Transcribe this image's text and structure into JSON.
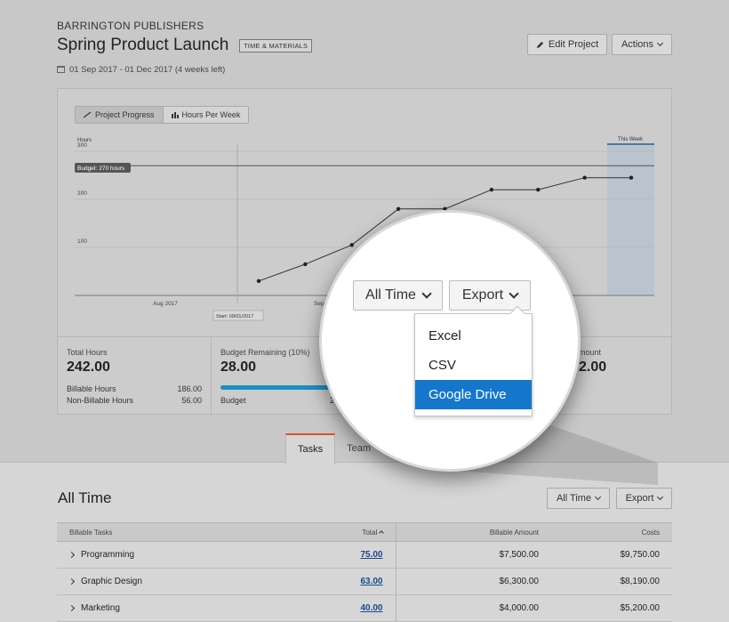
{
  "header": {
    "company": "BARRINGTON PUBLISHERS",
    "title": "Spring Product Launch",
    "tag": "TIME & MATERIALS",
    "dates": "01 Sep 2017 - 01 Dec 2017 (4 weeks left)",
    "edit_label": "Edit Project",
    "actions_label": "Actions"
  },
  "chart_toggle": {
    "progress": "Project Progress",
    "hours": "Hours Per Week"
  },
  "chart_data": {
    "type": "line",
    "ylabel": "Hours",
    "y_ticks": [
      100,
      200,
      300
    ],
    "ylim": [
      0,
      300
    ],
    "x_tick_labels": [
      "Aug 2017",
      "Sep"
    ],
    "budget_line": {
      "value": 270,
      "label": "Budget: 270 hours"
    },
    "start_marker": "Start: 09/01/2017",
    "this_week_label": "This Week",
    "series": [
      {
        "values": [
          30,
          65,
          105,
          180,
          180,
          220,
          220,
          245,
          245
        ]
      }
    ]
  },
  "stats": {
    "total_hours": {
      "label": "Total Hours",
      "value": "242.00",
      "billable_label": "Billable Hours",
      "billable_value": "186.00",
      "nonbillable_label": "Non-Billable Hours",
      "nonbillable_value": "56.00"
    },
    "budget_remaining": {
      "label": "Budget Remaining (10%)",
      "value": "28.00",
      "budget_label": "Budget",
      "budget_value_partial": "2",
      "progress": 0.9
    },
    "amount": {
      "label_partial": "mount",
      "value_partial": "2.00"
    }
  },
  "tabs": [
    "Tasks",
    "Team"
  ],
  "section": {
    "title": "All Time",
    "filter_label": "All Time",
    "export_label": "Export"
  },
  "table": {
    "columns": [
      "Billable Tasks",
      "Total",
      "Billable Amount",
      "Costs"
    ],
    "rows": [
      {
        "task": "Programming",
        "total": "75.00",
        "amount": "$7,500.00",
        "costs": "$9,750.00"
      },
      {
        "task": "Graphic Design",
        "total": "63.00",
        "amount": "$6,300.00",
        "costs": "$8,190.00"
      },
      {
        "task": "Marketing",
        "total": "40.00",
        "amount": "$4,000.00",
        "costs": "$5,200.00"
      }
    ]
  },
  "magnifier": {
    "filter_label": "All Time",
    "export_label": "Export",
    "menu": [
      "Excel",
      "CSV",
      "Google Drive"
    ],
    "selected": "Google Drive"
  },
  "colors": {
    "accent_tab": "#d9541e",
    "link": "#1a4a8f",
    "progress": "#1c8fc4",
    "menu_selected": "#1477cc",
    "this_week": "#b9c4cf"
  }
}
